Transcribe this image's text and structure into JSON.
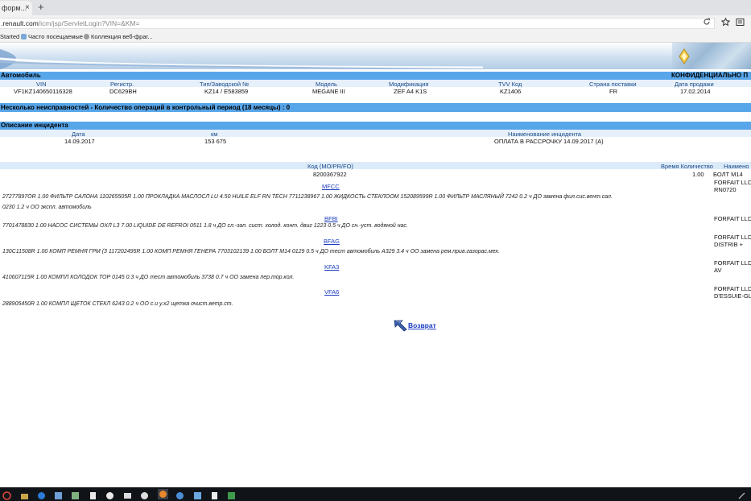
{
  "browser": {
    "tab_title": "форм...",
    "tab_close": "×",
    "new_tab": "+",
    "url_host": ".renault.com",
    "url_path": "/icm/jsp/ServletLogin?VIN=&KM=",
    "bookmarks": [
      "Started",
      "Часто посещаемые",
      "Коллекция веб-фраг..."
    ]
  },
  "vehicle": {
    "section_title": "Автомобиль",
    "confidential": "КОНФИДЕНЦИАЛЬНО П",
    "headers": [
      "VIN",
      "Регистр.",
      "Тип/Заводской №",
      "Модель",
      "Модификация",
      "TVV Код",
      "Страна поставки",
      "Дата продажи"
    ],
    "values": [
      "VF1KZ140650116328",
      "DC629BH",
      "KZ14 / E583859",
      "MEGANE III",
      "ZEF A4 K1S",
      "KZ1406",
      "FR",
      "17.02.2014"
    ]
  },
  "faults_bar": "Несколько неисправностей - Количество операций в контрольный период (18 месяцы) : 0",
  "incident": {
    "section_title": "Описание инцидента",
    "headers": [
      "Дата",
      "км",
      "Наименование инцидента"
    ],
    "values": [
      "14.09.2017",
      "153 675",
      "ОПЛАТА В РАССРОЧКУ 14.09.2017 (A)"
    ]
  },
  "ops_table": {
    "headers": [
      "Код (MO/PR/FO)",
      "Время Количество",
      "Наимено"
    ],
    "first_code": "8200367922",
    "first_qty": "1.00",
    "first_name": "БОЛТ М14",
    "lines": [
      "27277897OR   1.00  ФИЛЬТР САЛОНА   110265505R   1.00  ПРОКЛАДКА МАСЛОСЛ   LU   4.50  HUILE ELF RN TECH   7711238967   1.00  ЖИДКОСТЬ СТЕКЛООМ   152089599R   1.00  ФИЛЬТР МАСЛЯНЫЙ   7242 0.2 ч  ДО замена фил.сис.вент.сал.",
      "0230 1.2 ч   ОО экспл. автомобиль",
      "7701478830   1.00  НАСОС СИСТЕМЫ ОХЛ   L3   7.00  LIQUIDE DE REFROI   0511 1.8 ч  ДО сл.-зап. сист. холод. конт. двиг   1223 0.5 ч  ДО сн.-уст. водяной нас.",
      "130C11508R   1.00  КОМП РЕМНЯ ГРМ (3   117202495R   1.00  КОМП РЕМНЯ ГЕНЕРА   7703102139   1.00  БОЛТ М14   0129 0.5 ч   ДО тест автомобиль   A329 3.4 ч   ОО замена рем.прив.газорас.мех.",
      "410607115R   1.00  КОМПЛ КОЛОДОК ТОР   0145 0.3 ч   ДО тест автомобиль   3738 0.7 ч   ОО замена пер.тор.кол.",
      "288905450R   1.00  КОМПЛ ЩЕТОК СТЕКЛ   6243 0.2 ч   ОО с.и у.х2 щетка очист.ветр.ст."
    ],
    "codes": [
      "MFCC",
      "BFBI",
      "BFAG",
      "KFA3",
      "VFA6"
    ],
    "right_texts": [
      "FORFAIT LLD I",
      "RN0720",
      "FORFAIT LLD I",
      "FORFAIT LLD I",
      "DISTRIB +",
      "FORFAIT LLD I",
      "AV",
      "FORFAIT LLD I",
      "D'ESSUIE-GLA"
    ]
  },
  "back_label": "Возврат",
  "icons": {
    "reload": "reload-icon",
    "star": "bookmark-star-icon",
    "menu": "menu-icon"
  }
}
